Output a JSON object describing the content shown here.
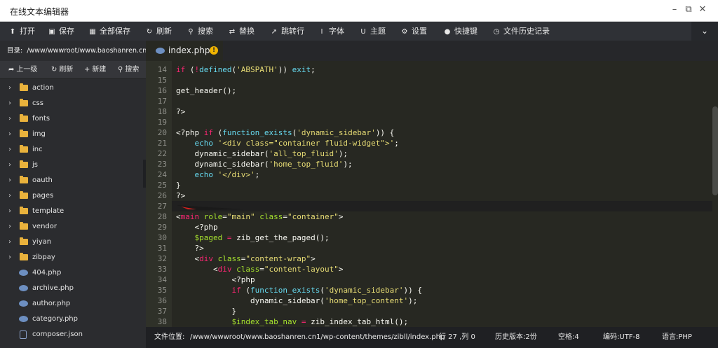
{
  "window": {
    "title": "在线文本编辑器"
  },
  "toolbar": {
    "items": [
      {
        "label": "打开",
        "icon": "upload-icon"
      },
      {
        "label": "保存",
        "icon": "save-icon"
      },
      {
        "label": "全部保存",
        "icon": "save-all-icon"
      },
      {
        "label": "刷新",
        "icon": "refresh-icon"
      },
      {
        "label": "搜索",
        "icon": "search-icon"
      },
      {
        "label": "替换",
        "icon": "replace-icon"
      },
      {
        "label": "跳转行",
        "icon": "jump-line-icon"
      },
      {
        "label": "字体",
        "icon": "font-icon"
      },
      {
        "label": "主题",
        "icon": "theme-icon"
      },
      {
        "label": "设置",
        "icon": "gear-icon"
      },
      {
        "label": "快捷键",
        "icon": "shortcut-icon"
      },
      {
        "label": "文件历史记录",
        "icon": "history-icon"
      }
    ]
  },
  "sidebar": {
    "dir_label": "目录:",
    "dir_path": "/www/wwwroot/www.baoshanren.cn",
    "actions": [
      {
        "label": "上一级",
        "icon": "up-icon"
      },
      {
        "label": "刷新",
        "icon": "refresh-icon"
      },
      {
        "label": "新建",
        "icon": "plus-icon"
      },
      {
        "label": "搜索",
        "icon": "search-icon"
      }
    ],
    "folders": [
      "action",
      "css",
      "fonts",
      "img",
      "inc",
      "js",
      "oauth",
      "pages",
      "template",
      "vendor",
      "yiyan",
      "zibpay"
    ],
    "files": [
      {
        "name": "404.php",
        "type": "php"
      },
      {
        "name": "archive.php",
        "type": "php"
      },
      {
        "name": "author.php",
        "type": "php"
      },
      {
        "name": "category.php",
        "type": "php"
      },
      {
        "name": "composer.json",
        "type": "json"
      }
    ]
  },
  "tab": {
    "label": "index.php",
    "warning": "!"
  },
  "editor": {
    "current_line": 27,
    "lines": [
      {
        "n": "14",
        "indent": 0,
        "tokens": [
          [
            "k",
            "if"
          ],
          [
            "p",
            " ("
          ],
          [
            "k",
            "!"
          ],
          [
            "f",
            "defined"
          ],
          [
            "p",
            "("
          ],
          [
            "s",
            "'ABSPATH'"
          ],
          [
            "p",
            ")) "
          ],
          [
            "f",
            "exit"
          ],
          [
            "p",
            ";"
          ]
        ]
      },
      {
        "n": "15",
        "indent": 0,
        "tokens": []
      },
      {
        "n": "16",
        "indent": 0,
        "tokens": [
          [
            "p",
            "get_header();"
          ]
        ]
      },
      {
        "n": "17",
        "indent": 0,
        "tokens": []
      },
      {
        "n": "18",
        "indent": 0,
        "tokens": [
          [
            "p",
            "?>"
          ]
        ]
      },
      {
        "n": "19",
        "indent": 0,
        "tokens": []
      },
      {
        "n": "20",
        "indent": 0,
        "tokens": [
          [
            "p",
            "<?php "
          ],
          [
            "k",
            "if"
          ],
          [
            "p",
            " ("
          ],
          [
            "f",
            "function_exists"
          ],
          [
            "p",
            "("
          ],
          [
            "s",
            "'dynamic_sidebar'"
          ],
          [
            "p",
            ")) {"
          ]
        ]
      },
      {
        "n": "21",
        "indent": 1,
        "tokens": [
          [
            "f",
            "echo"
          ],
          [
            "p",
            " "
          ],
          [
            "s",
            "'<div class=\"container fluid-widget\">'"
          ],
          [
            "p",
            ";"
          ]
        ]
      },
      {
        "n": "22",
        "indent": 1,
        "tokens": [
          [
            "p",
            "dynamic_sidebar("
          ],
          [
            "s",
            "'all_top_fluid'"
          ],
          [
            "p",
            ");"
          ]
        ]
      },
      {
        "n": "23",
        "indent": 1,
        "tokens": [
          [
            "p",
            "dynamic_sidebar("
          ],
          [
            "s",
            "'home_top_fluid'"
          ],
          [
            "p",
            ");"
          ]
        ]
      },
      {
        "n": "24",
        "indent": 1,
        "tokens": [
          [
            "f",
            "echo"
          ],
          [
            "p",
            " "
          ],
          [
            "s",
            "'</div>'"
          ],
          [
            "p",
            ";"
          ]
        ]
      },
      {
        "n": "25",
        "indent": 0,
        "tokens": [
          [
            "p",
            "}"
          ]
        ]
      },
      {
        "n": "26",
        "indent": 0,
        "tokens": [
          [
            "p",
            "?>"
          ]
        ]
      },
      {
        "n": "27",
        "indent": 0,
        "tokens": []
      },
      {
        "n": "28",
        "indent": 0,
        "tokens": [
          [
            "p",
            "<"
          ],
          [
            "k",
            "main"
          ],
          [
            "p",
            " "
          ],
          [
            "v",
            "role"
          ],
          [
            "p",
            "="
          ],
          [
            "s",
            "\"main\""
          ],
          [
            "p",
            " "
          ],
          [
            "v",
            "class"
          ],
          [
            "p",
            "="
          ],
          [
            "s",
            "\"container\""
          ],
          [
            "p",
            ">"
          ]
        ]
      },
      {
        "n": "29",
        "indent": 1,
        "tokens": [
          [
            "p",
            "<?php"
          ]
        ]
      },
      {
        "n": "30",
        "indent": 1,
        "tokens": [
          [
            "v",
            "$paged"
          ],
          [
            "p",
            " "
          ],
          [
            "k",
            "="
          ],
          [
            "p",
            " zib_get_the_paged();"
          ]
        ]
      },
      {
        "n": "31",
        "indent": 1,
        "tokens": [
          [
            "p",
            "?>"
          ]
        ]
      },
      {
        "n": "32",
        "indent": 1,
        "tokens": [
          [
            "p",
            "<"
          ],
          [
            "k",
            "div"
          ],
          [
            "p",
            " "
          ],
          [
            "v",
            "class"
          ],
          [
            "p",
            "="
          ],
          [
            "s",
            "\"content-wrap\""
          ],
          [
            "p",
            ">"
          ]
        ]
      },
      {
        "n": "33",
        "indent": 2,
        "tokens": [
          [
            "p",
            "<"
          ],
          [
            "k",
            "div"
          ],
          [
            "p",
            " "
          ],
          [
            "v",
            "class"
          ],
          [
            "p",
            "="
          ],
          [
            "s",
            "\"content-layout\""
          ],
          [
            "p",
            ">"
          ]
        ]
      },
      {
        "n": "34",
        "indent": 3,
        "tokens": [
          [
            "p",
            "<?php"
          ]
        ]
      },
      {
        "n": "35",
        "indent": 3,
        "tokens": [
          [
            "k",
            "if"
          ],
          [
            "p",
            " ("
          ],
          [
            "f",
            "function_exists"
          ],
          [
            "p",
            "("
          ],
          [
            "s",
            "'dynamic_sidebar'"
          ],
          [
            "p",
            ")) {"
          ]
        ]
      },
      {
        "n": "36",
        "indent": 4,
        "tokens": [
          [
            "p",
            "dynamic_sidebar("
          ],
          [
            "s",
            "'home_top_content'"
          ],
          [
            "p",
            ");"
          ]
        ]
      },
      {
        "n": "37",
        "indent": 3,
        "tokens": [
          [
            "p",
            "}"
          ]
        ]
      },
      {
        "n": "38",
        "indent": 3,
        "tokens": [
          [
            "v",
            "$index_tab_nav"
          ],
          [
            "p",
            " "
          ],
          [
            "k",
            "="
          ],
          [
            "p",
            " zib_index_tab_html();"
          ]
        ]
      }
    ]
  },
  "status": {
    "path_label": "文件位置:",
    "path": "/www/wwwroot/www.baoshanren.cn1/wp-content/themes/zibll/index.php",
    "cursor": "行 27 ,列 0",
    "history": "历史版本:2份",
    "spaces": "空格:4",
    "encoding": "编码:UTF-8",
    "language": "语言:PHP"
  }
}
